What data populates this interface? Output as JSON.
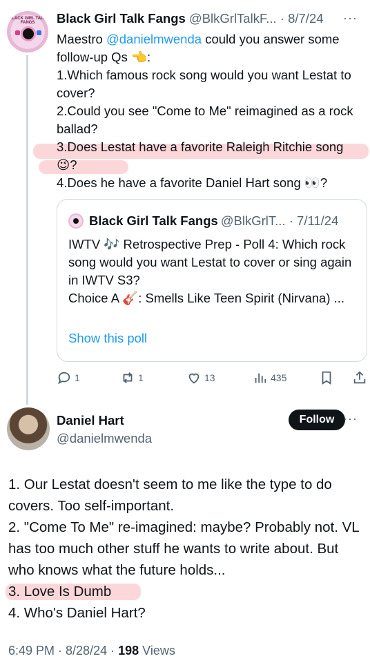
{
  "tweet": {
    "author_name": "Black Girl Talk Fangs",
    "handle": "@BlkGrlTalkF...",
    "date": "· 8/7/24",
    "more": "···",
    "avatar_text": "BLACK GIRL TALK FANGS",
    "line1_prefix": "Maestro ",
    "line1_mention": "@danielmwenda",
    "line1_suffix": " could you answer some",
    "line2": "follow-up Qs 👈:",
    "q1": "1.Which famous rock song would you want Lestat to cover?",
    "q2": "2.Could you see \"Come to Me\" reimagined as a rock ballad?",
    "q3": "3.Does Lestat have a favorite Raleigh Ritchie song 😉?",
    "q4": "4.Does he have a favorite Daniel Hart song 👀?"
  },
  "quoted": {
    "author_name": "Black Girl Talk Fangs",
    "handle": "@BlkGrlT... · 7/11/24",
    "text1": "IWTV 🎶 Retrospective Prep - Poll 4: Which rock song would you want Lestat to cover or sing again in IWTV S3?",
    "text2": "Choice A 🎸: Smells Like Teen Spirit (Nirvana) ...",
    "show_poll": "Show this poll"
  },
  "actions": {
    "replies": "1",
    "retweets": "1",
    "likes": "13",
    "views": "435"
  },
  "reply": {
    "author_name": "Daniel Hart",
    "handle": "@danielmwenda",
    "follow_label": "Follow",
    "more": "···",
    "p1": "1. Our Lestat doesn't seem to me like the type to do covers. Too self-important.",
    "p2": "2. \"Come To Me\" re-imagined: maybe? Probably not. VL has too much other stuff he wants to write about. But who knows what the future holds...",
    "p3": "3. Love Is Dumb",
    "p4": "4. Who's Daniel Hart?",
    "time": "6:49 PM · 8/28/24 · ",
    "views_count": "198",
    "views_label": " Views"
  },
  "colors": {
    "accent": "#1d9bf0",
    "text": "#0f1419",
    "muted": "#536471",
    "highlight": "#f7a0a5"
  },
  "icons": [
    "reply-icon",
    "retweet-icon",
    "like-icon",
    "views-icon",
    "bookmark-icon",
    "share-icon"
  ]
}
